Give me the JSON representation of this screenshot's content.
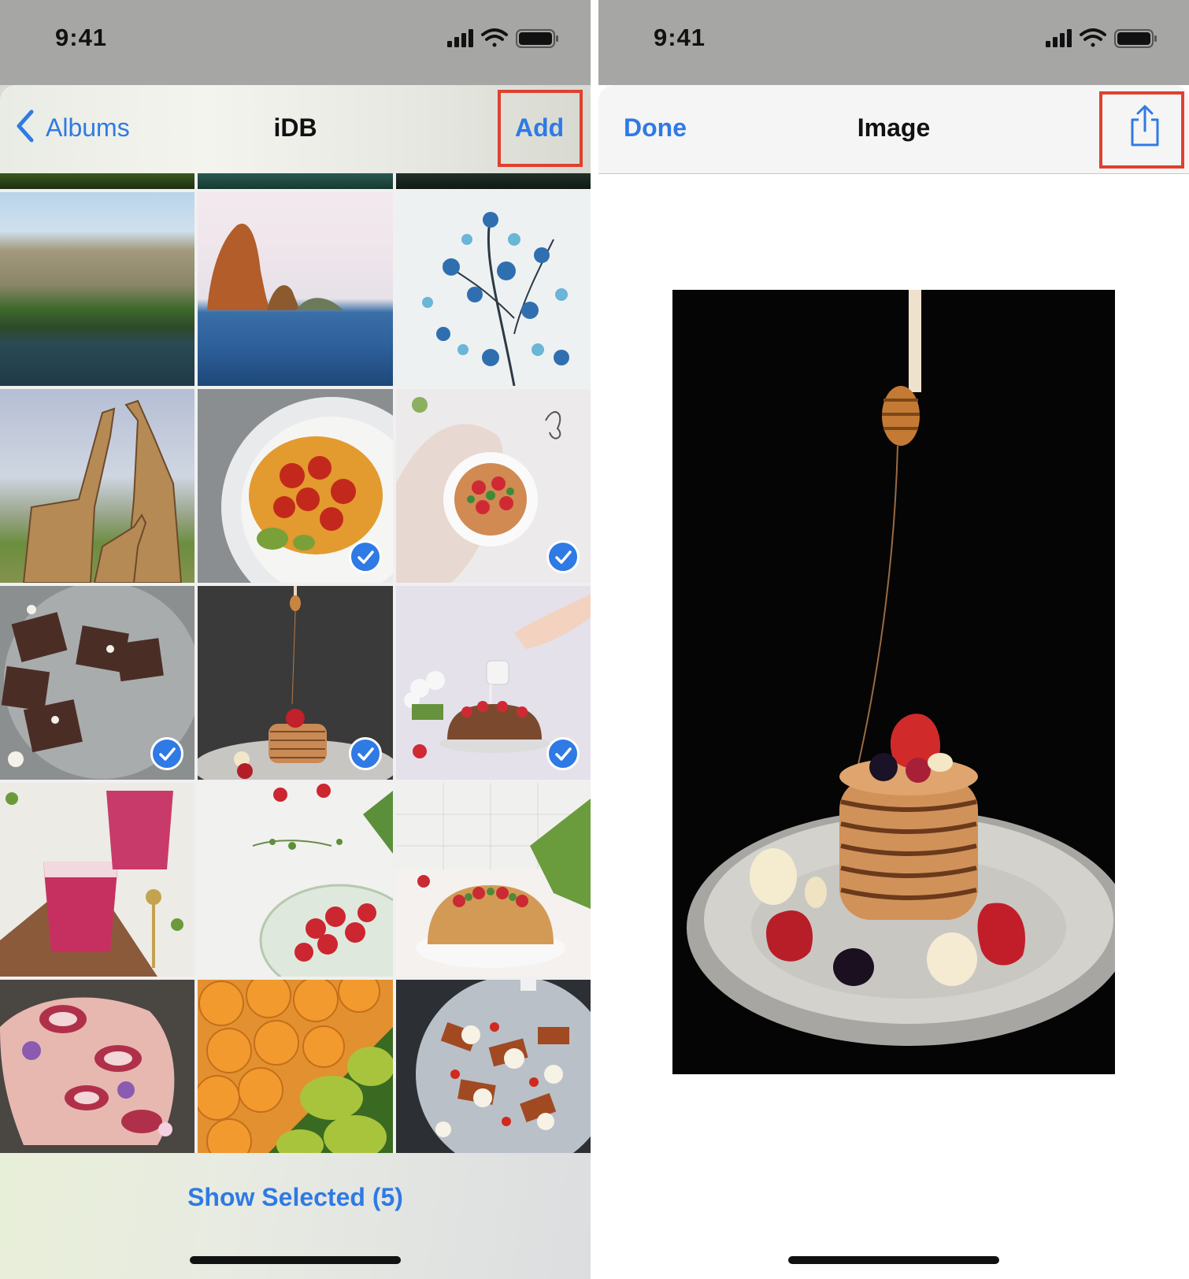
{
  "left_screen": {
    "status": {
      "time": "9:41"
    },
    "nav": {
      "back_label": "Albums",
      "title": "iDB",
      "add_label": "Add"
    },
    "bottom": {
      "show_selected": "Show Selected (5)"
    },
    "photos": [
      {
        "name": "photo-cliffs",
        "selected": false
      },
      {
        "name": "photo-island",
        "selected": false
      },
      {
        "name": "photo-blue-flowers",
        "selected": false
      },
      {
        "name": "photo-giraffes",
        "selected": false
      },
      {
        "name": "photo-tomato-dish",
        "selected": true
      },
      {
        "name": "photo-strawberry-cake",
        "selected": true
      },
      {
        "name": "photo-brownies",
        "selected": true
      },
      {
        "name": "photo-pancakes",
        "selected": true
      },
      {
        "name": "photo-bundt-cake",
        "selected": true
      },
      {
        "name": "photo-pink-drinks",
        "selected": false
      },
      {
        "name": "photo-strawberries-bowl",
        "selected": false
      },
      {
        "name": "photo-bundt-strawberry",
        "selected": false
      },
      {
        "name": "photo-figs",
        "selected": false
      },
      {
        "name": "photo-oranges-pears",
        "selected": false
      },
      {
        "name": "photo-roasted-plate",
        "selected": false
      }
    ]
  },
  "right_screen": {
    "status": {
      "time": "9:41"
    },
    "nav": {
      "done_label": "Done",
      "title": "Image"
    },
    "image_subject": "pancakes-with-honey-dipper"
  },
  "colors": {
    "accent": "#2f7ae4",
    "highlight": "#e0402e"
  }
}
